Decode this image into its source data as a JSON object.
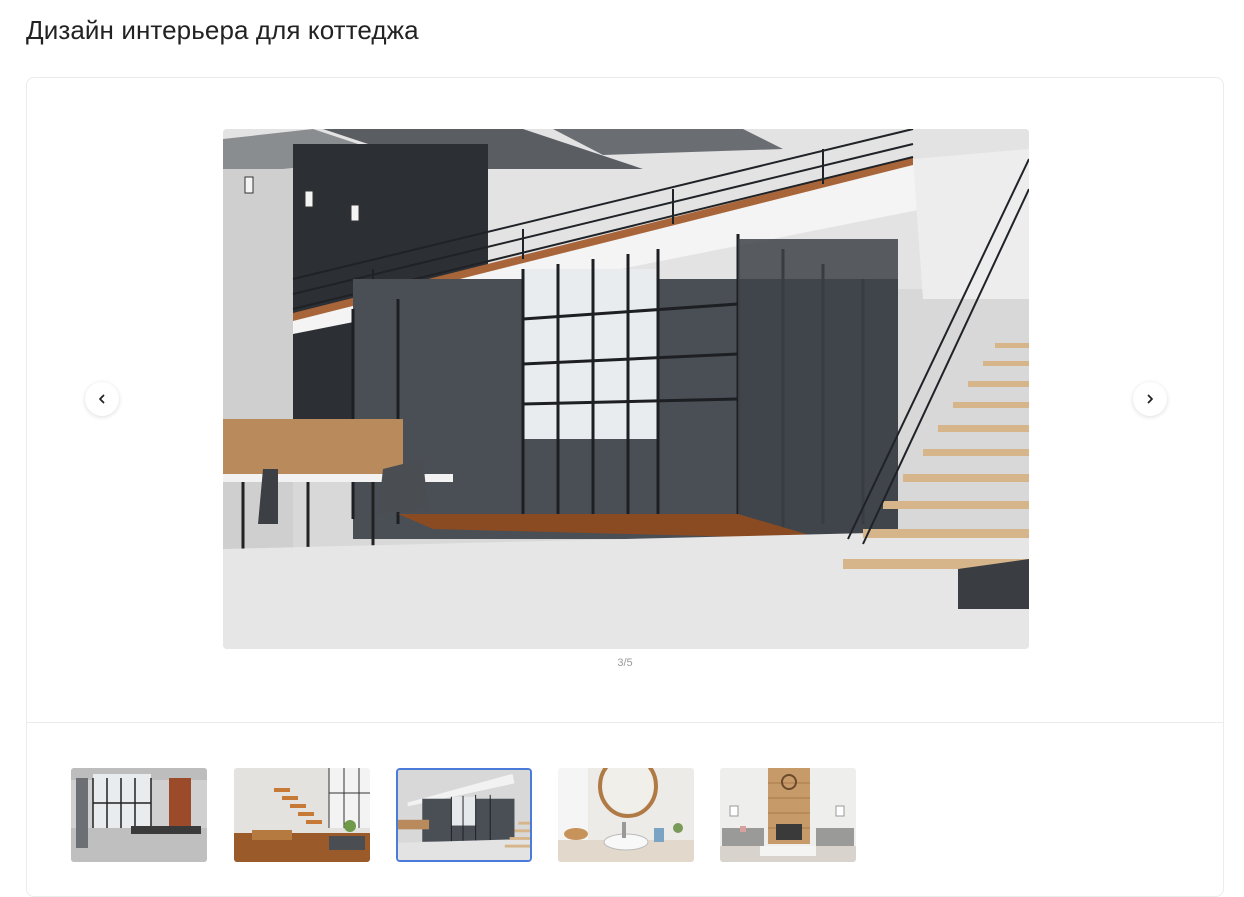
{
  "page": {
    "title": "Дизайн интерьера для коттеджа"
  },
  "gallery": {
    "counter": "3/5",
    "current_index": 3,
    "total": 5,
    "prev_icon": "chevron-left-icon",
    "next_icon": "chevron-right-icon",
    "accent_color": "#4a7bd8",
    "thumbnails": [
      {
        "scene": "loft-office-windows"
      },
      {
        "scene": "living-room-wooden-stairs"
      },
      {
        "scene": "loft-office-glass-cubicle"
      },
      {
        "scene": "bathroom-round-mirror"
      },
      {
        "scene": "living-room-fireplace"
      }
    ]
  }
}
